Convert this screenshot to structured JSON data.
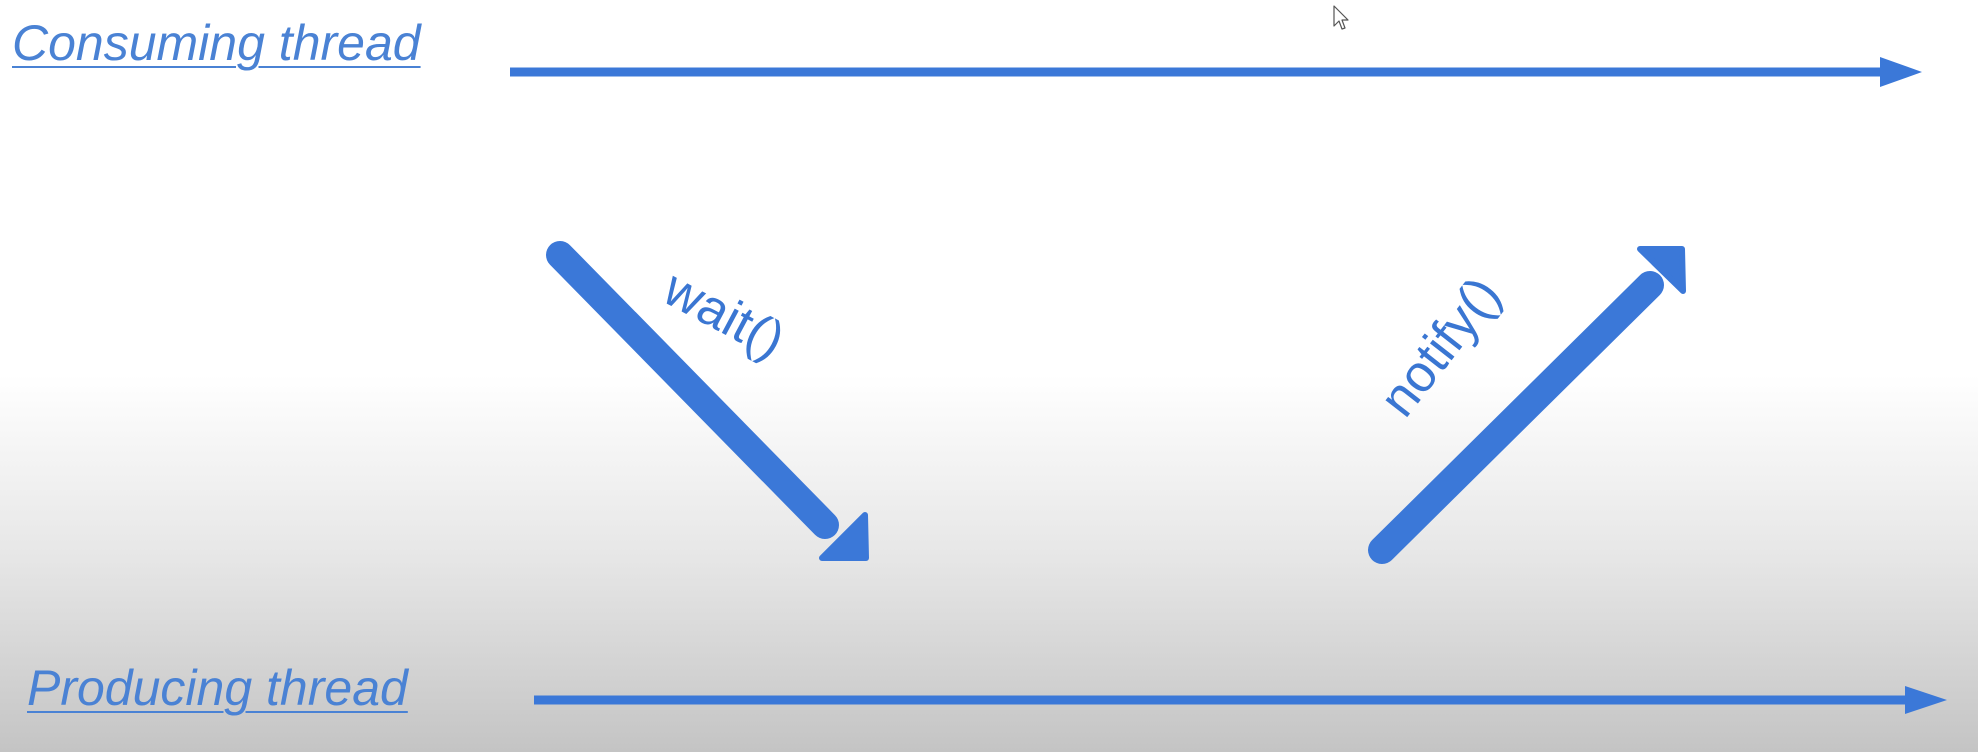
{
  "labels": {
    "consuming_thread": "Consuming thread",
    "producing_thread": "Producing thread",
    "wait_call": "wait()",
    "notify_call": "notify()"
  },
  "colors": {
    "arrow": "#3b78d8",
    "label_text": "#4a82d4",
    "call_text": "#3a76d2",
    "background_top": "#ffffff",
    "background_bottom": "#c4c4c4"
  },
  "icons": {
    "cursor": "mouse-pointer-icon"
  }
}
